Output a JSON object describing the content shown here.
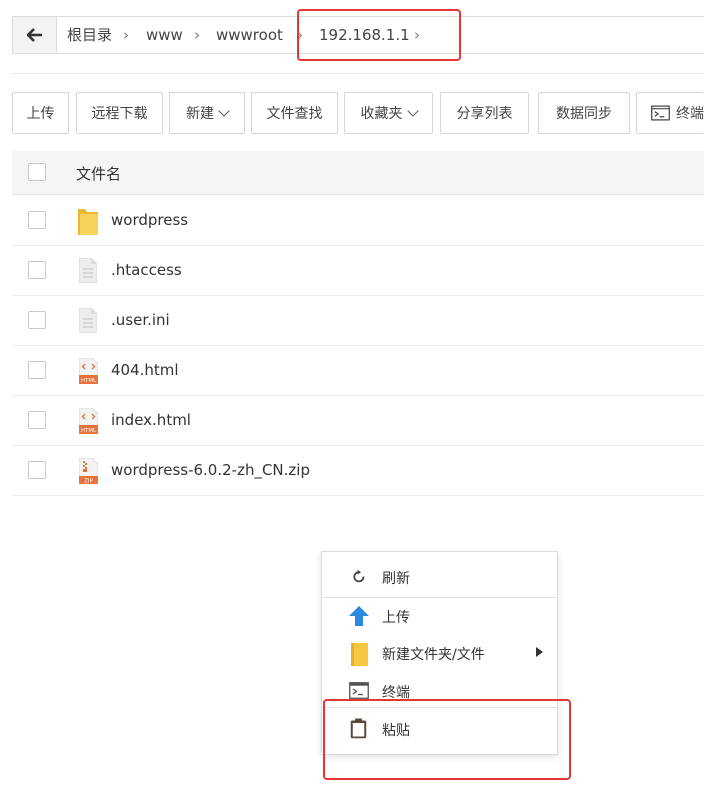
{
  "breadcrumb": {
    "items": [
      "根目录",
      "www",
      "wwwroot",
      "192.168.1.1"
    ],
    "separator": "›"
  },
  "toolbar": {
    "upload": "上传",
    "remote_download": "远程下载",
    "new": "新建",
    "file_search": "文件查找",
    "favorites": "收藏夹",
    "share_list": "分享列表",
    "data_sync": "数据同步",
    "terminal": "终端"
  },
  "table": {
    "header_name": "文件名",
    "rows": [
      {
        "name": "wordpress",
        "icon": "folder-icon"
      },
      {
        "name": ".htaccess",
        "icon": "text-file-icon"
      },
      {
        "name": ".user.ini",
        "icon": "text-file-icon"
      },
      {
        "name": "404.html",
        "icon": "html-file-icon"
      },
      {
        "name": "index.html",
        "icon": "html-file-icon"
      },
      {
        "name": "wordpress-6.0.2-zh_CN.zip",
        "icon": "zip-file-icon"
      }
    ]
  },
  "context_menu": {
    "refresh": "刷新",
    "upload": "上传",
    "new_folder_file": "新建文件夹/文件",
    "terminal": "终端",
    "paste": "粘贴"
  },
  "colors": {
    "highlight": "#e53535",
    "upload_arrow": "#2b8ae0",
    "folder": "#f5c842",
    "html_badge": "#e8743b"
  }
}
